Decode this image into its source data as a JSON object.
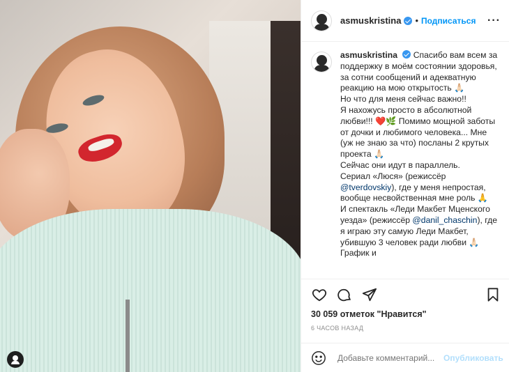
{
  "header": {
    "username": "asmuskristina",
    "separator": "•",
    "follow_label": "Подписаться",
    "more_label": "···"
  },
  "caption": {
    "username": "asmuskristina",
    "text": "Спасибо вам всем за поддержку в моём состоянии здоровья, за сотни сообщений и адекватную реакцию на мою открытость 🙏🏻\nНо что для меня сейчас важно!!\nЯ нахожусь просто в абсолютной любви!!! ❤️🌿 Помимо мощной заботы от дочки и любимого человека... Мне (уж не знаю за что) посланы 2 крутых проекта 🙏🏻\nСейчас они идут в параллель.\nСериал «Люся» (режиссёр ",
    "mention1": "@tverdovskiy",
    "text2": "), где у меня непростая, вообще несвойственная мне роль 🙏\nИ спектакль «Леди Макбет Мценского уезда» (режиссёр ",
    "mention2": "@danil_chaschin",
    "text3": "), где я играю эту самую Леди Макбет, убившую 3 человек ради любви 🙏🏻 График и"
  },
  "actions": {
    "like_icon": "heart-icon",
    "comment_icon": "comment-icon",
    "share_icon": "share-icon",
    "save_icon": "bookmark-icon"
  },
  "likes": {
    "count": "30 059",
    "label_mid": " отметок ",
    "label_end": "\"Нравится\""
  },
  "time": "6 часов назад",
  "comment": {
    "placeholder": "Добавьте комментарий...",
    "post_label": "Опубликовать"
  },
  "colors": {
    "accent": "#0095f6",
    "verified": "#3897f0",
    "post_disabled": "#b2dffc"
  }
}
